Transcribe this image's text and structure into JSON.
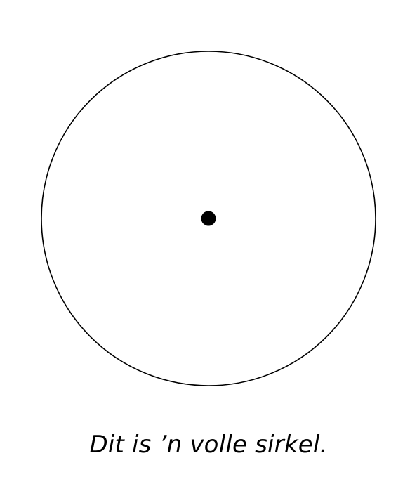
{
  "caption": "Dit is ’n volle sirkel.",
  "colors": {
    "background": "#ffffff",
    "stroke": "#000000",
    "center_dot": "#000000"
  },
  "figure": {
    "shape": "circle",
    "fill": "none",
    "center_marker": "filled-dot"
  }
}
